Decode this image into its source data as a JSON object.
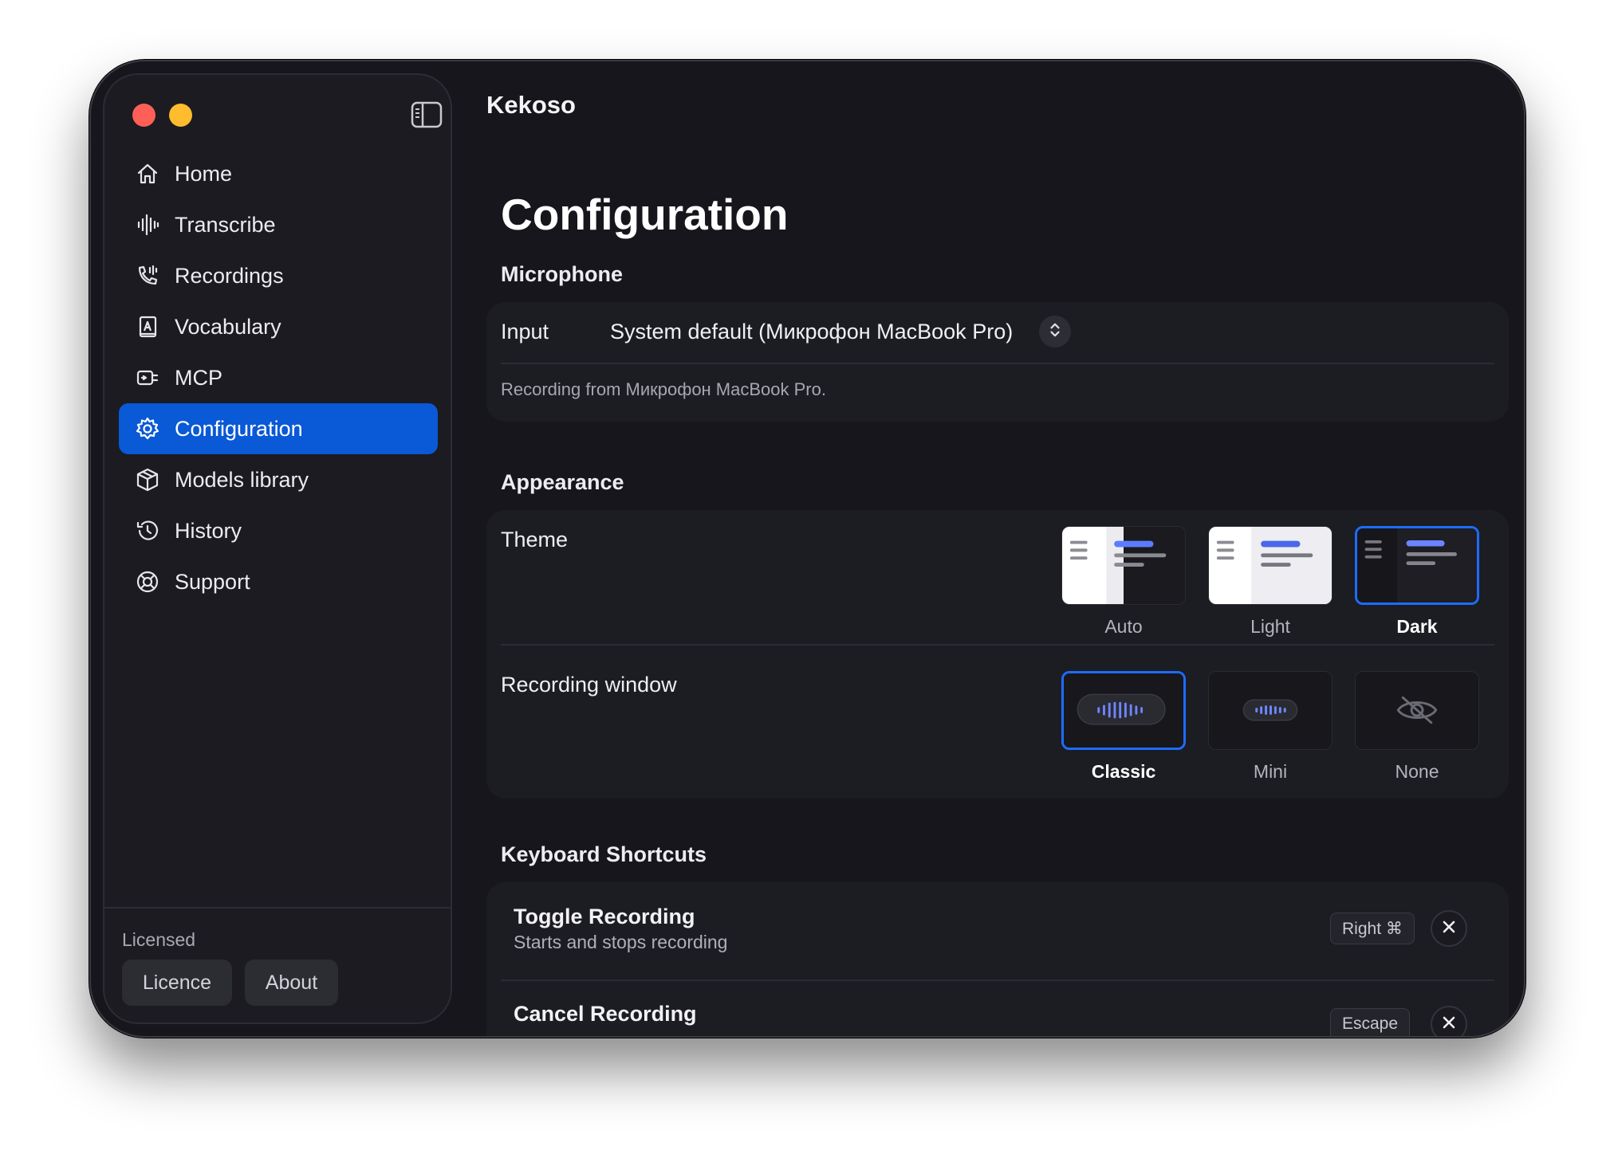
{
  "app": {
    "title": "Kekoso"
  },
  "sidebar": {
    "items": [
      {
        "label": "Home",
        "icon": "home-icon"
      },
      {
        "label": "Transcribe",
        "icon": "waveform-icon"
      },
      {
        "label": "Recordings",
        "icon": "phone-wave-icon"
      },
      {
        "label": "Vocabulary",
        "icon": "dictionary-icon"
      },
      {
        "label": "MCP",
        "icon": "plug-icon"
      },
      {
        "label": "Configuration",
        "icon": "gear-icon",
        "active": true
      },
      {
        "label": "Models library",
        "icon": "cube-icon"
      },
      {
        "label": "History",
        "icon": "history-icon"
      },
      {
        "label": "Support",
        "icon": "lifebuoy-icon"
      }
    ],
    "license_status": "Licensed",
    "licence_button": "Licence",
    "about_button": "About"
  },
  "main": {
    "page_title": "Configuration",
    "microphone": {
      "section_title": "Microphone",
      "input_label": "Input",
      "input_value": "System default (Микрофон MacBook Pro)",
      "hint": "Recording from Микрофон MacBook Pro."
    },
    "appearance": {
      "section_title": "Appearance",
      "theme_label": "Theme",
      "theme_options": [
        "Auto",
        "Light",
        "Dark"
      ],
      "theme_selected": "Dark",
      "recording_window_label": "Recording window",
      "recording_window_options": [
        "Classic",
        "Mini",
        "None"
      ],
      "recording_window_selected": "Classic"
    },
    "shortcuts": {
      "section_title": "Keyboard Shortcuts",
      "items": [
        {
          "title": "Toggle Recording",
          "description": "Starts and stops recording",
          "key": "Right ⌘"
        },
        {
          "title": "Cancel Recording",
          "key": "Escape"
        }
      ]
    }
  },
  "colors": {
    "accent": "#0a59d6",
    "selection_border": "#1e6cff",
    "window_bg": "#16161c"
  }
}
